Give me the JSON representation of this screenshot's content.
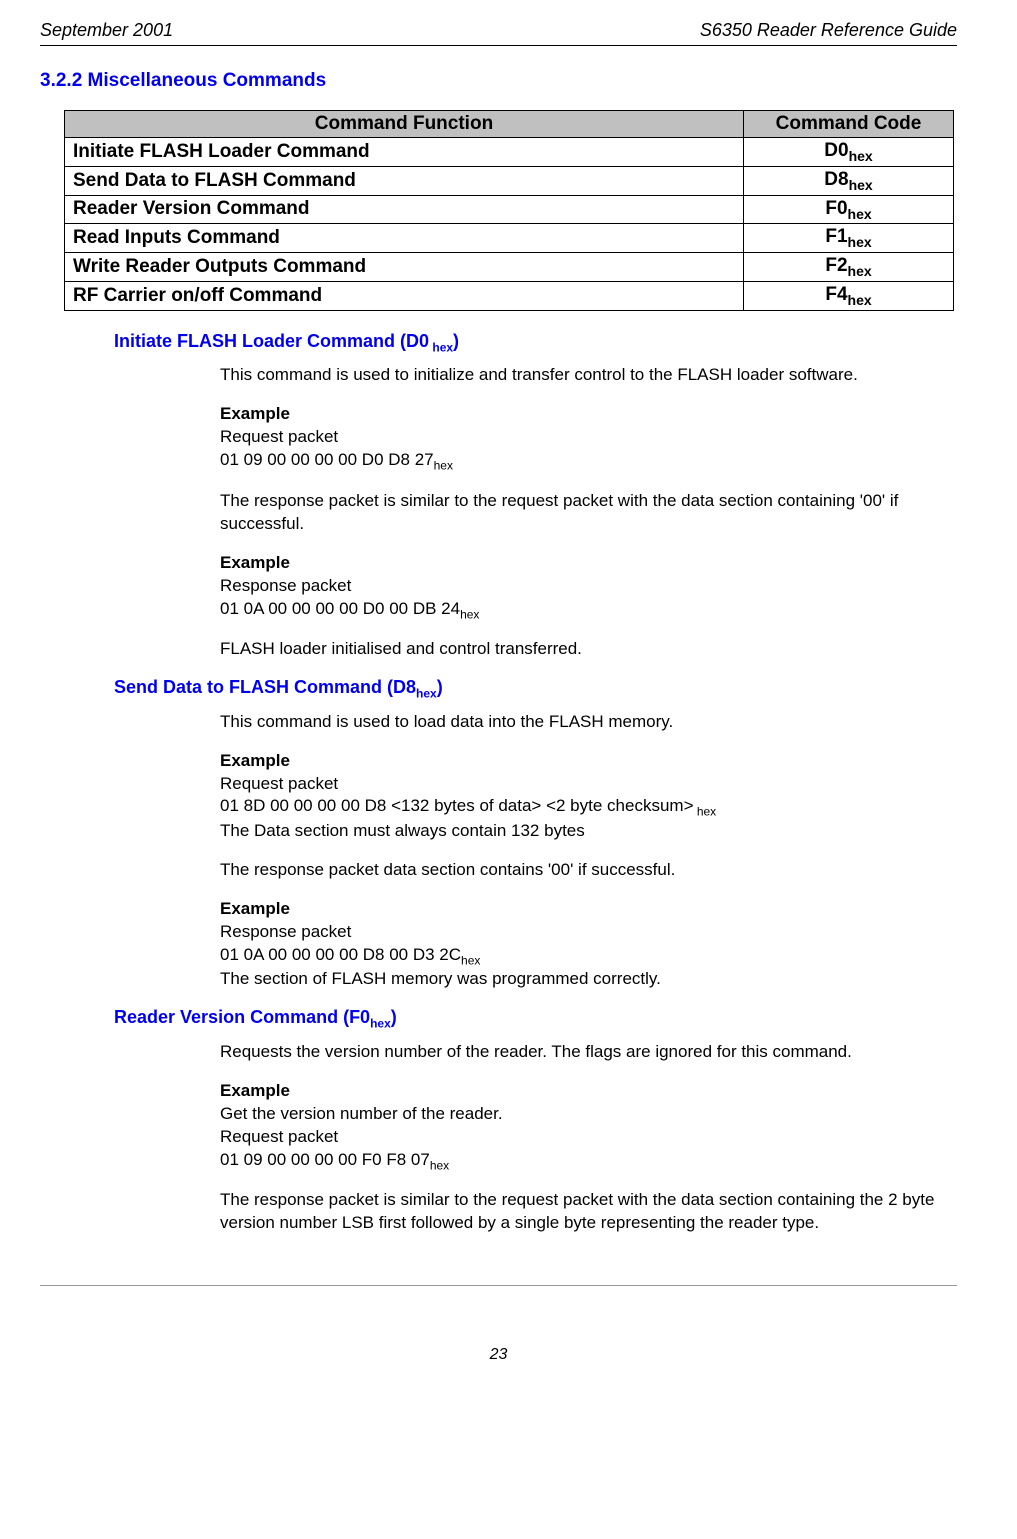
{
  "header": {
    "left": "September 2001",
    "right": "S6350 Reader Reference Guide"
  },
  "section_heading": "3.2.2  Miscellaneous Commands",
  "table": {
    "headers": {
      "func": "Command Function",
      "code": "Command Code"
    },
    "rows": [
      {
        "func": "Initiate FLASH Loader Command",
        "code": "D0",
        "sub": "hex"
      },
      {
        "func": "Send Data to FLASH Command",
        "code": "D8",
        "sub": "hex"
      },
      {
        "func": "Reader Version Command",
        "code": "F0",
        "sub": "hex"
      },
      {
        "func": "Read Inputs Command",
        "code": "F1",
        "sub": "hex"
      },
      {
        "func": "Write Reader Outputs Command",
        "code": "F2",
        "sub": "hex"
      },
      {
        "func": "RF Carrier on/off Command",
        "code": "F4",
        "sub": "hex"
      }
    ]
  },
  "sections": {
    "initiate": {
      "heading_main": "Initiate FLASH Loader Command (D0",
      "heading_sub": " hex",
      "heading_close": ")",
      "p1": "This command is used to initialize and transfer control to the FLASH loader software.",
      "ex1_label": "Example",
      "ex1_line1": "Request packet",
      "ex1_line2_main": "01 09 00 00 00 00 D0 D8 27",
      "ex1_line2_sub": "hex",
      "p2": "The response packet is similar to the request packet with the data section containing '00' if successful.",
      "ex2_label": "Example",
      "ex2_line1": "Response packet",
      "ex2_line2_main": "01 0A 00 00 00 00 D0 00 DB 24",
      "ex2_line2_sub": "hex",
      "p3": "FLASH loader initialised and control transferred."
    },
    "senddata": {
      "heading_main": "Send Data to FLASH Command (D8",
      "heading_sub": "hex",
      "heading_close": ")",
      "p1": "This command is used to load data into the FLASH memory.",
      "ex1_label": "Example",
      "ex1_line1": "Request packet",
      "ex1_line2_main": "01 8D 00 00 00 00 D8 <132 bytes of data> <2 byte checksum>",
      "ex1_line2_sub": " hex",
      "ex1_line3": "The Data section must always contain 132 bytes",
      "p2": "The response packet data section contains '00' if successful.",
      "ex2_label": "Example",
      "ex2_line1": "Response packet",
      "ex2_line2_main": "01 0A 00 00 00 00 D8 00 D3 2C",
      "ex2_line2_sub": "hex",
      "ex2_line3": "The section of FLASH memory was programmed correctly."
    },
    "reader": {
      "heading_main": "Reader Version Command (F0",
      "heading_sub": "hex",
      "heading_close": ")",
      "p1": "Requests the version number of the reader. The flags are ignored for this command.",
      "ex1_label": "Example",
      "ex1_line1": "Get the version number of the reader.",
      "ex1_line2": "Request packet",
      "ex1_line3_main": "01 09 00 00 00 00 F0 F8 07",
      "ex1_line3_sub": "hex",
      "p2": "The response packet is similar to the request packet with the data section containing the 2 byte version number LSB first followed by a single byte representing the reader type."
    }
  },
  "page_number": "23"
}
